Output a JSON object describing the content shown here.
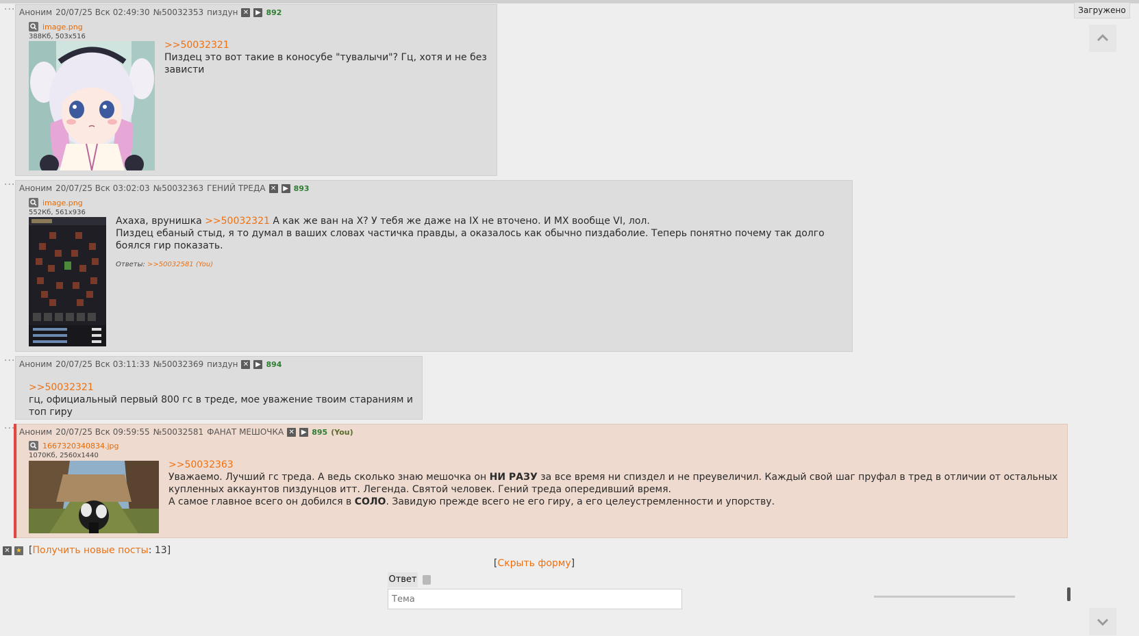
{
  "status": {
    "loaded": "Загружено"
  },
  "posts": [
    {
      "header": {
        "name": "Аноним",
        "date": "20/07/25 Вск 02:49:30",
        "num": "№50032353",
        "tag": "пиздун",
        "count": "892",
        "you": ""
      },
      "file": {
        "name": "image.png",
        "meta": "388Кб, 503x516"
      },
      "body": {
        "link1": ">>50032321",
        "text1": "Пиздец это вот такие в коносубе \"тувалычи\"? Гц, хотя и не без зависти"
      }
    },
    {
      "header": {
        "name": "Аноним",
        "date": "20/07/25 Вск 03:02:03",
        "num": "№50032363",
        "tag": "ГЕНИЙ ТРЕДА",
        "count": "893",
        "you": ""
      },
      "file": {
        "name": "image.png",
        "meta": "552Кб, 561x936"
      },
      "body": {
        "text1a": "Ахаха, врунишка ",
        "link1": ">>50032321",
        "text1b": " А как же ван на X? У тебя же даже на IX не вточено. И MX вообще VI, лол.",
        "text2": "Пиздец ебаный стыд, я то думал в ваших словах частичка правды, а оказалось как обычно пиздаболие. Теперь понятно почему так долго боялся гир показать.",
        "replies_label": "Ответы: ",
        "replies_link": ">>50032581 (You)"
      }
    },
    {
      "header": {
        "name": "Аноним",
        "date": "20/07/25 Вск 03:11:33",
        "num": "№50032369",
        "tag": "пиздун",
        "count": "894",
        "you": ""
      },
      "body": {
        "link1": ">>50032321",
        "text1": "гц, официальный первый 800 гс в треде, мое уважение твоим стараниям и топ гиру"
      }
    },
    {
      "header": {
        "name": "Аноним",
        "date": "20/07/25 Вск 09:59:55",
        "num": "№50032581",
        "tag": "ФАНАТ МЕШОЧКА",
        "count": "895",
        "you": "(You)"
      },
      "file": {
        "name": "1667320340834.jpg",
        "meta": "1070Кб, 2560x1440"
      },
      "body": {
        "link1": ">>50032363",
        "t1": "Уважаемо. Лучший гс треда. А ведь сколько знаю мешочка он ",
        "b1": "НИ РАЗУ",
        "t2": " за все время ни спиздел и не преувеличил. Каждый свой шаг пруфал в тред в отличии от остальных купленных аккаунтов пиздунцов итт. Легенда. Святой человек. Гений треда опередивший время.",
        "t3": "А самое главное всего он добился в ",
        "b2": "СОЛО",
        "t4": ". Завидую прежде всего не его гиру, а его целеустремленности и упорству."
      }
    }
  ],
  "footer": {
    "get_new_label": "Получить новые посты",
    "get_new_count": ": 13]",
    "hide_form": "Скрыть форму",
    "reply_tab": "Ответ",
    "theme_placeholder": "Тема"
  }
}
